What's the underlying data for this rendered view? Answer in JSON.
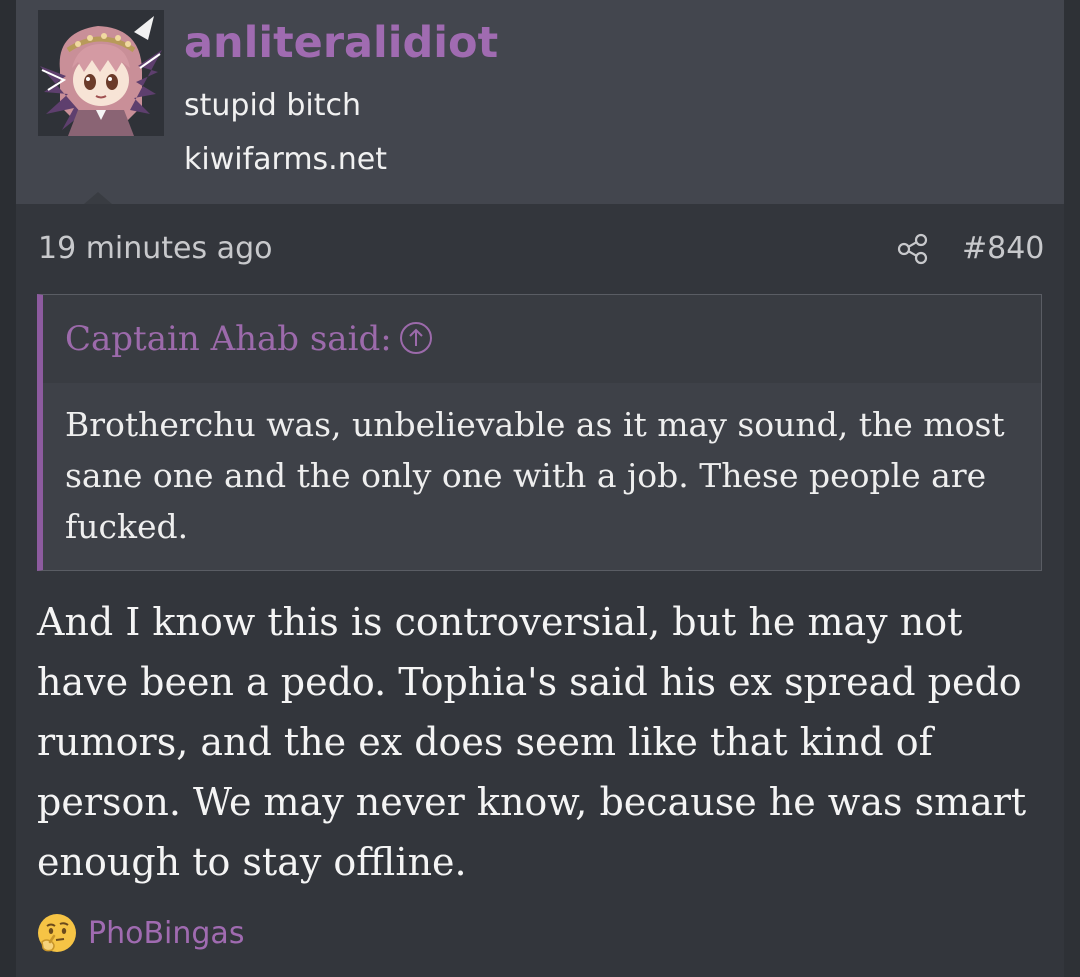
{
  "user": {
    "name": "anliteralidiot",
    "title": "stupid bitch",
    "site": "kiwifarms.net",
    "avatar_icon": "anime-girl-avatar"
  },
  "post": {
    "timestamp": "19 minutes ago",
    "number": "#840",
    "share_icon": "share-icon",
    "body": "And I know this is controversial, but he may not have been a pedo. Tophia's said his ex spread pedo rumors, and the ex does seem like that kind of person. We may never know, because he was smart enough to stay offline."
  },
  "quote": {
    "author": "Captain Ahab said:",
    "jump_icon": "arrow-up-circle-icon",
    "text": "Brotherchu was, unbelievable as it may sound, the most sane one and the only one with a job. These people are fucked."
  },
  "reactions": {
    "icon": "thinking-face-icon",
    "users": "PhoBingas"
  },
  "colors": {
    "accent": "#a06bb1",
    "background": "#33363c",
    "header_background": "#43464e",
    "quote_border": "#8d5b9f"
  }
}
